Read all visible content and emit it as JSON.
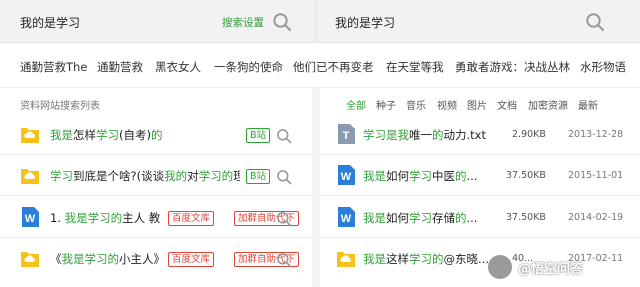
{
  "search_left": {
    "query": "我的是学习",
    "advanced_label": "搜索设置"
  },
  "search_right": {
    "query": "我的是学习"
  },
  "tags": [
    "通勤营救The",
    "通勤营救",
    "黑衣女人",
    "一条狗的使命",
    "他们已不再变老",
    "在天堂等我",
    "勇敢者游戏：决战丛林",
    "水形物语"
  ],
  "left_panel": {
    "title": "资料网站搜索列表",
    "rows": [
      {
        "icon": "cloud-folder-icon",
        "parts": [
          [
            "我是",
            true
          ],
          [
            "怎样",
            false
          ],
          [
            "学习",
            true
          ],
          [
            "(自考)",
            false
          ],
          [
            "的",
            true
          ]
        ],
        "badges": [
          {
            "text": "B站",
            "color": "green"
          }
        ]
      },
      {
        "icon": "cloud-folder-icon",
        "parts": [
          [
            "学习",
            true
          ],
          [
            "到底是个啥?(谈谈",
            false
          ],
          [
            "我的",
            true
          ],
          [
            "对",
            false
          ],
          [
            "学习的",
            true
          ],
          [
            "理",
            false
          ]
        ],
        "badges": [
          {
            "text": "B站",
            "color": "green"
          }
        ]
      },
      {
        "icon": "word-doc-icon",
        "parts": [
          [
            "1. ",
            false
          ],
          [
            "我是学习的",
            true
          ],
          [
            "主人 教",
            false
          ]
        ],
        "badges": [
          {
            "text": "百度文库",
            "color": "red"
          },
          {
            "text": "加群自助代下",
            "color": "red"
          }
        ]
      },
      {
        "icon": "cloud-folder-icon",
        "parts": [
          [
            "《",
            false
          ],
          [
            "我是学习的",
            true
          ],
          [
            "小主人》",
            false
          ]
        ],
        "badges": [
          {
            "text": "百度文库",
            "color": "red"
          },
          {
            "text": "加群自助代下",
            "color": "red"
          }
        ]
      }
    ]
  },
  "right_panel": {
    "filters": [
      "全部",
      "种子",
      "音乐",
      "视频",
      "图片",
      "文档",
      "加密资源",
      "最新"
    ],
    "active_filter": "全部",
    "rows": [
      {
        "icon": "text-file-icon",
        "parts": [
          [
            "学习是我",
            true
          ],
          [
            "唯一",
            false
          ],
          [
            "的",
            true
          ],
          [
            "动力.txt",
            false
          ]
        ],
        "size": "2.90KB",
        "date": "2013-12-28"
      },
      {
        "icon": "word-doc-icon",
        "parts": [
          [
            "我是",
            true
          ],
          [
            "如何",
            false
          ],
          [
            "学习",
            true
          ],
          [
            "中医",
            false
          ],
          [
            "的",
            true
          ],
          [
            "...",
            false
          ]
        ],
        "size": "37.50KB",
        "date": "2015-11-01"
      },
      {
        "icon": "word-doc-icon",
        "parts": [
          [
            "我是",
            true
          ],
          [
            "如何",
            false
          ],
          [
            "学习",
            true
          ],
          [
            "存储",
            false
          ],
          [
            "的",
            true
          ],
          [
            "...",
            false
          ]
        ],
        "size": "37.50KB",
        "date": "2014-02-19"
      },
      {
        "icon": "cloud-folder-icon",
        "parts": [
          [
            "我是",
            true
          ],
          [
            "这样",
            false
          ],
          [
            "学习的",
            true
          ],
          [
            "@东晓...",
            false
          ]
        ],
        "size": "40...",
        "date": "2017-02-11"
      }
    ]
  },
  "watermark": {
    "text": "@悟空问答"
  },
  "colors": {
    "accent": "#2fa037",
    "badge_red": "#e0453a",
    "folder": "#f5c21b",
    "word": "#2b7fd6",
    "txt": "#8a9bb0"
  }
}
